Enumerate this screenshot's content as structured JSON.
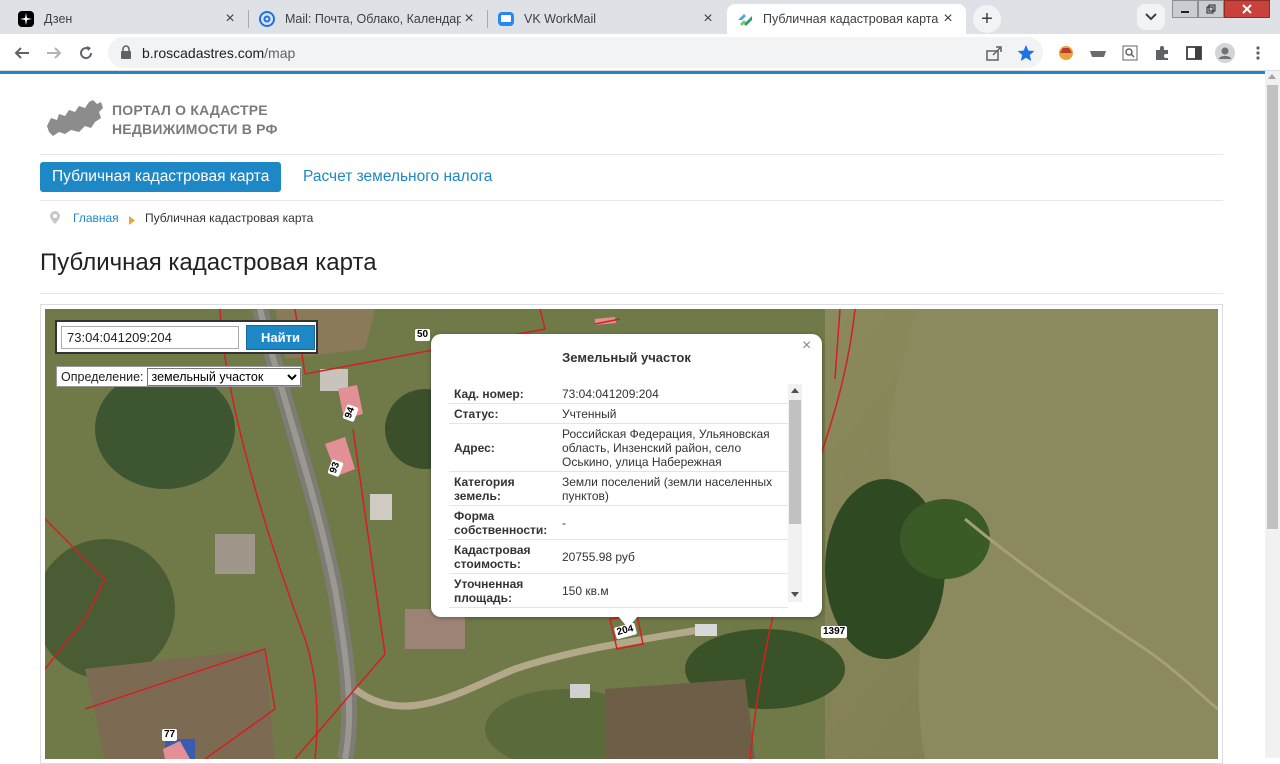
{
  "browser": {
    "tabs": [
      {
        "title": "Дзен",
        "icon": "dzen-icon"
      },
      {
        "title": "Mail: Почта, Облако, Календарь",
        "icon": "mail-at-icon"
      },
      {
        "title": "VK WorkMail",
        "icon": "vk-workmail-icon"
      },
      {
        "title": "Публичная кадастровая карта",
        "icon": "roscadastres-icon",
        "active": true
      }
    ],
    "url_host": "b.roscadastres.com",
    "url_path": "/map"
  },
  "site": {
    "logo_line1": "ПОРТАЛ О КАДАСТРЕ",
    "logo_line2": "НЕДВИЖИМОСТИ В РФ",
    "menu": [
      {
        "label": "Публичная кадастровая карта",
        "active": true
      },
      {
        "label": "Расчет земельного налога",
        "active": false
      }
    ],
    "breadcrumb": {
      "home": "Главная",
      "current": "Публичная кадастровая карта"
    },
    "page_title": "Публичная кадастровая карта"
  },
  "map": {
    "search_value": "73:04:041209:204",
    "search_button": "Найти",
    "definition_label": "Определение:",
    "definition_value": "земельный участок",
    "labels": [
      "50",
      "94",
      "93",
      "204",
      "1397",
      "77"
    ],
    "popup": {
      "title": "Земельный участок",
      "rows": [
        {
          "key": "Кад. номер:",
          "value": "73:04:041209:204"
        },
        {
          "key": "Статус:",
          "value": "Учтенный"
        },
        {
          "key": "Адрес:",
          "value": "Российская Федерация, Ульяновская область, Инзенский район, село Оськино, улица Набережная"
        },
        {
          "key": "Категория земель:",
          "value": "Земли поселений (земли населенных пунктов)"
        },
        {
          "key": "Форма собственности:",
          "value": "-"
        },
        {
          "key": "Кадастровая стоимость:",
          "value": "20755.98 руб"
        },
        {
          "key": "Уточненная площадь:",
          "value": "150 кв.м"
        }
      ]
    }
  },
  "colors": {
    "accent": "#1e88c7",
    "boundary": "#d42020",
    "tabbar": "#dee1e6"
  }
}
